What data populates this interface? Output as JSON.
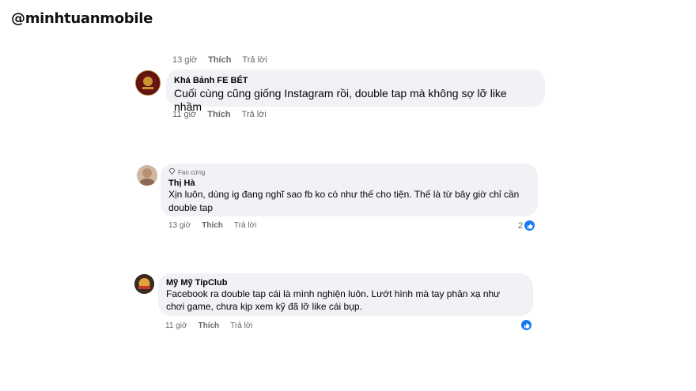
{
  "watermark": "@minhtuanmobile",
  "comment0": {
    "time": "13 giờ",
    "like": "Thích",
    "reply": "Trả lời"
  },
  "comment1": {
    "author": "Khá Bảnh FE BÉT",
    "text": "Cuối cùng cũng giống Instagram rồi, double tap mà không sợ lỡ like nhầm",
    "time": "11 giờ",
    "like": "Thích",
    "reply": "Trả lời"
  },
  "comment2": {
    "badge": "Fan cứng",
    "author": "Thị Hà",
    "text": "Xịn luôn, dùng ig đang nghĩ sao fb ko có như thế cho tiện. Thế là từ bây giờ chỉ cần double tap",
    "time": "13 giờ",
    "like": "Thích",
    "reply": "Trả lời",
    "reaction_count": "2"
  },
  "comment3": {
    "author": "Mỹ Mỹ TipClub",
    "text": "Facebook ra double tap cái là mình nghiện luôn. Lướt hình mà tay phản xạ như chơi game, chưa kịp xem kỹ đã lỡ like cái bụp.",
    "time": "11 giờ",
    "like": "Thích",
    "reply": "Trả lời"
  },
  "colors": {
    "bubble": "#f0f2f5",
    "like_blue": "#1877f2",
    "meta": "#65676b"
  },
  "icons": [
    "avatar",
    "diamond-icon",
    "like-icon"
  ]
}
